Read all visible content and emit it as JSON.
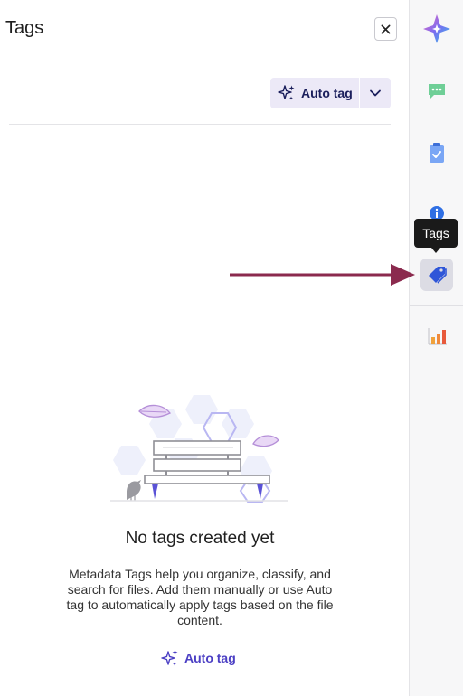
{
  "panel": {
    "title": "Tags",
    "close_icon": "close-icon"
  },
  "toolbar": {
    "autotag_label": "Auto tag",
    "autotag_icon": "sparkle-icon",
    "dropdown_icon": "chevron-down-icon"
  },
  "empty_state": {
    "title": "No tags created yet",
    "description": "Metadata Tags help you organize, classify, and search for files. Add them manually or use Auto tag to automatically apply tags based on the file content.",
    "link_label": "Auto tag",
    "illustration": "bench-with-bird-illustration"
  },
  "rail": {
    "items": [
      {
        "name": "ai-assistant",
        "icon": "sparkle-star-icon"
      },
      {
        "name": "comments",
        "icon": "chat-bubble-icon"
      },
      {
        "name": "tasks",
        "icon": "clipboard-check-icon"
      },
      {
        "name": "info",
        "icon": "info-icon"
      },
      {
        "name": "tags",
        "icon": "tag-icon",
        "active": true
      },
      {
        "name": "insights",
        "icon": "bar-chart-icon"
      }
    ]
  },
  "tooltip": {
    "text": "Tags"
  },
  "annotation": {
    "arrow_color": "#8b2a4e"
  },
  "colors": {
    "accent": "#4b3fc4",
    "button_bg": "#ece9f7",
    "button_text": "#1b1f5c"
  }
}
